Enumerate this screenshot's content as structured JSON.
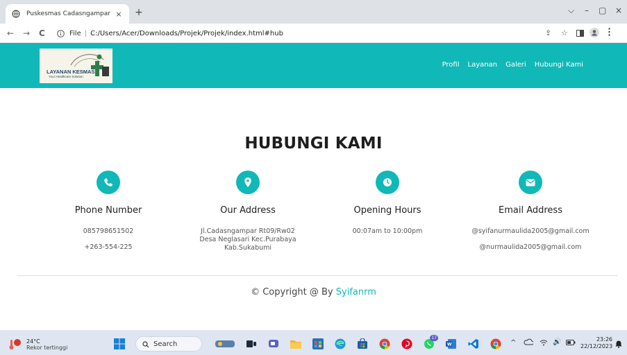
{
  "browser": {
    "tab_title": "Puskesmas Cadasngampar",
    "tab_close": "×",
    "new_tab": "+",
    "address_prefix": "File",
    "address_separator": "|",
    "url": "C:/Users/Acer/Downloads/Projek/Projek/index.html#hub",
    "back_glyph": "←",
    "forward_glyph": "→",
    "reload_glyph": "C",
    "share_glyph": "⇪",
    "bookmark_glyph": "☆",
    "window_controls": {
      "menu": "⌵",
      "minimize": "–",
      "maximize": "▢",
      "close": "×"
    }
  },
  "site": {
    "logo": {
      "name": "LAYANAN KESMAS",
      "tagline": "Your Healthcare Solution"
    },
    "nav": [
      "Profil",
      "Layanan",
      "Galeri",
      "Hubungi Kami"
    ],
    "accent_color": "#10b8b8"
  },
  "contact": {
    "title": "HUBUNGI KAMI",
    "columns": [
      {
        "icon": "phone-icon",
        "heading": "Phone Number",
        "lines": [
          "085798651502",
          "+263-554-225"
        ]
      },
      {
        "icon": "location-pin-icon",
        "heading": "Our Address",
        "lines": [
          "Jl.Cadasngampar Rt09/Rw02 Desa Neglasari Kec.Purabaya Kab.Sukabumi"
        ]
      },
      {
        "icon": "clock-icon",
        "heading": "Opening Hours",
        "lines": [
          "00:07am to 10:00pm"
        ]
      },
      {
        "icon": "envelope-icon",
        "heading": "Email Address",
        "lines": [
          "@syifanurmaulida2005@gmail.com",
          "@nurmaulida2005@gmail.com"
        ]
      }
    ]
  },
  "footer": {
    "copyright_prefix": "© Copyright @ By ",
    "author": "Syifanrm"
  },
  "taskbar": {
    "weather": {
      "temp": "24°C",
      "condition": "Rekor tertinggi"
    },
    "search_label": "Search",
    "apps": [
      "windows-start-icon",
      "search-box",
      "widgets-icon",
      "task-view-icon",
      "teams-chat-icon",
      "file-explorer-icon",
      "ms-store-icon",
      "edge-icon",
      "store-icon",
      "chrome-icon",
      "pinterest-icon",
      "whatsapp-icon",
      "word-icon",
      "vscode-icon",
      "chrome-active-icon"
    ],
    "whatsapp_badge": "17",
    "tray": {
      "chevron": "^",
      "volume": "🔊"
    },
    "clock": {
      "time": "23:26",
      "date": "22/12/2023"
    }
  }
}
